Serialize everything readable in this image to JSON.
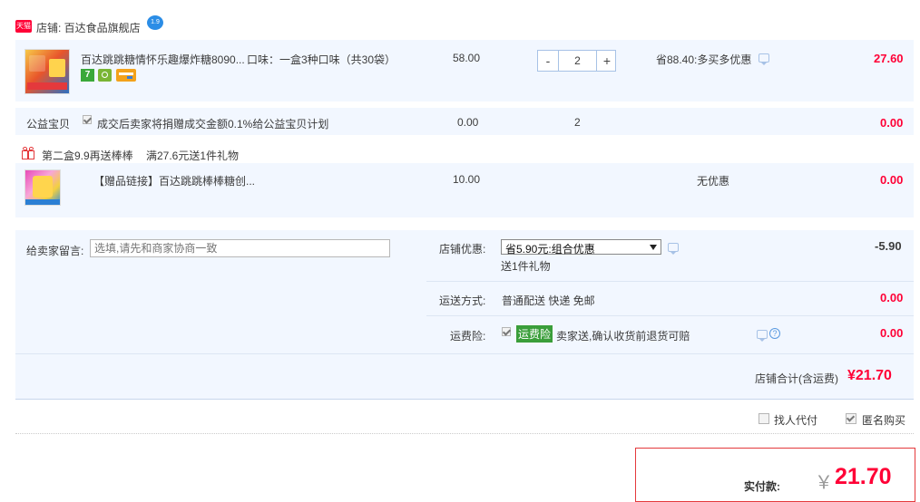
{
  "shop": {
    "tmall_badge": "天猫",
    "label": "店铺: 百达食品旗舰店",
    "chat_badge": "1.9"
  },
  "item1": {
    "title": "百达跳跳糖情怀乐趣爆炸糖8090...",
    "spec": "口味：一盒3种口味（共30袋）",
    "price": "58.00",
    "qty": "2",
    "qty_minus": "-",
    "qty_plus": "+",
    "discount": "省88.40:多买多优惠",
    "subtotal": "27.60",
    "tags": [
      "7",
      "",
      ""
    ]
  },
  "charity": {
    "label": "公益宝贝",
    "desc": "成交后卖家将捐赠成交金额0.1%给公益宝贝计划",
    "price": "0.00",
    "qty": "2",
    "subtotal": "0.00"
  },
  "promo": {
    "text1": "第二盒9.9再送棒棒",
    "text2": "满27.6元送1件礼物"
  },
  "gift": {
    "title": "【赠品链接】百达跳跳棒棒糖创...",
    "price": "10.00",
    "discount": "无优惠",
    "subtotal": "0.00"
  },
  "message": {
    "label": "给卖家留言:",
    "placeholder": "选填,请先和商家协商一致"
  },
  "shop_discount": {
    "label": "店铺优惠:",
    "selected": "省5.90元:组合优惠",
    "gift_note": "送1件礼物",
    "amount": "-5.90"
  },
  "shipping": {
    "label": "运送方式:",
    "value": "普通配送 快递 免邮",
    "amount": "0.00"
  },
  "insurance": {
    "label": "运费险:",
    "badge": "运费险",
    "desc": "卖家送,确认收货前退货可赔",
    "amount": "0.00"
  },
  "shop_total": {
    "label": "店铺合计(含运费)",
    "amount": "¥21.70"
  },
  "options": {
    "proxy_pay": "找人代付",
    "anonymous": "匿名购买"
  },
  "final": {
    "label": "实付款:",
    "currency": "￥",
    "amount": "21.70"
  },
  "colors": {
    "accent_red": "#ff0036",
    "row_bg": "#f2f7ff",
    "border_blue": "#a7c2e6",
    "insurance_green": "#3a9e3a",
    "final_border": "#e4393c"
  }
}
